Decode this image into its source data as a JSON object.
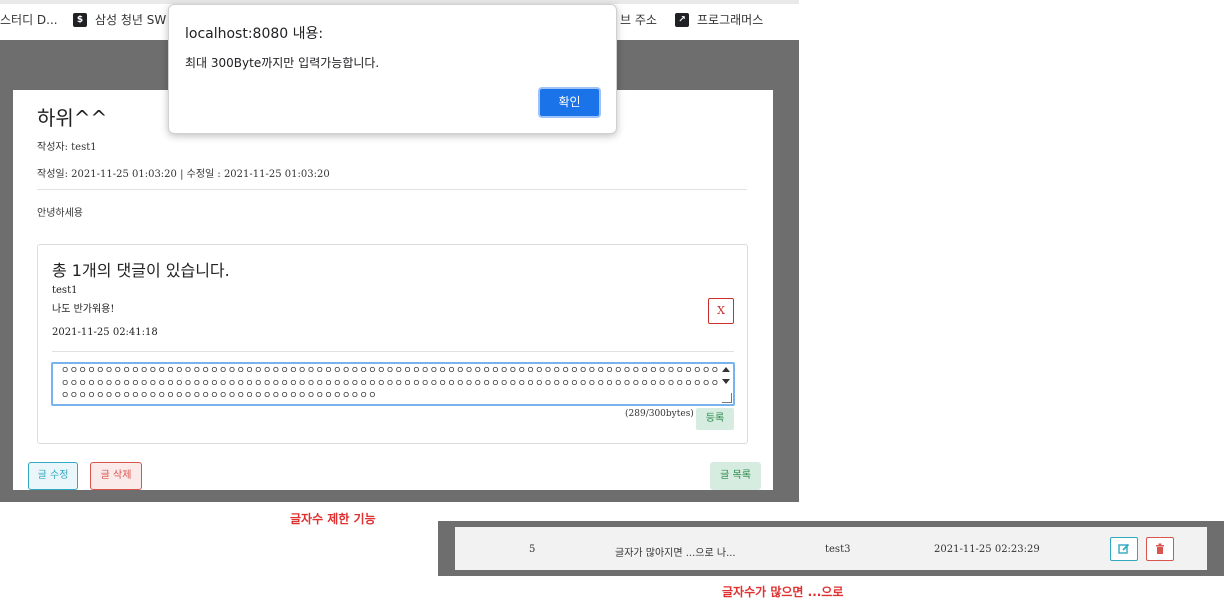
{
  "bookmarks": [
    {
      "label": "스터디 D...",
      "icon": "bookmark-icon"
    },
    {
      "label": "삼성 청년 SW",
      "icon": "dollar-icon"
    },
    {
      "label": "브 주소",
      "icon": ""
    },
    {
      "label": "프로그래머스",
      "icon": "programmers-icon"
    }
  ],
  "post": {
    "title": "하위^^",
    "author_line": "작성자: test1",
    "date_line": "작성일: 2021-11-25 01:03:20 | 수정일 : 2021-11-25 01:03:20",
    "content": "안녕하세용"
  },
  "comments": {
    "heading": "총 1개의 댓글이 있습니다.",
    "items": [
      {
        "author": "test1",
        "text": "나도 반가워용!",
        "date": "2021-11-25 02:41:18",
        "delete_label": "X"
      }
    ],
    "input_value": "ㅇㅇㅇㅇㅇㅇㅇㅇㅇㅇㅇㅇㅇㅇㅇㅇㅇㅇㅇㅇㅇㅇㅇㅇㅇㅇㅇㅇㅇㅇㅇㅇㅇㅇㅇㅇㅇㅇㅇㅇㅇㅇㅇㅇㅇㅇㅇㅇㅇㅇㅇㅇㅇㅇㅇㅇㅇㅇㅇㅇㅇㅇㅇㅇㅇㅇㅇㅇㅇㅇㅇㅇㅇㅇㅇㅇㅇㅇㅇㅇㅇㅇㅇㅇㅇㅇㅇㅇㅇㅇㅇㅇㅇㅇㅇㅇㅇㅇㅇㅇㅇㅇㅇㅇㅇㅇㅇㅇㅇㅇㅇㅇㅇㅇㅇㅇㅇㅇㅇㅇㅇㅇㅇㅇㅇㅇㅇㅇㅇㅇㅇㅇㅇㅇㅇㅇㅇㅇㅇㅇㅇㅇㅇㅇㅇㅇㅇㅇㅇㅇㅇㅇㅇㅇㅇㅇㅇㅇㅇㅇㅇㅇㅇㅇㅇㅇㅇㅇㅇㅇㅇㅇㅇㅇㅇㅇㅇㅇㅇㅇㅇㅇㅇㅇㅇㅇ",
    "counter": "(289/300bytes)",
    "submit_label": "등록"
  },
  "actions": {
    "edit_label": "글 수정",
    "delete_label": "글 삭제",
    "list_label": "글 목록"
  },
  "dialog": {
    "title": "localhost:8080 내용:",
    "message": "최대 300Byte까지만 입력가능합니다.",
    "ok_label": "확인"
  },
  "captions": {
    "first": "글자수 제한 기능",
    "second": "글자수가 많으면 ...으로"
  },
  "list_row": {
    "number": "5",
    "title": "글자가 많아지면 ...으로 나...",
    "author": "test3",
    "date": "2021-11-25 02:23:29",
    "edit_icon": "edit-icon",
    "delete_icon": "trash-icon"
  },
  "colors": {
    "overlay": "#6e6e6e",
    "primary": "#1a73e8",
    "info": "#31a9c1",
    "danger": "#d9534f",
    "success": "#2a8a4c",
    "caption": "#e03030"
  }
}
